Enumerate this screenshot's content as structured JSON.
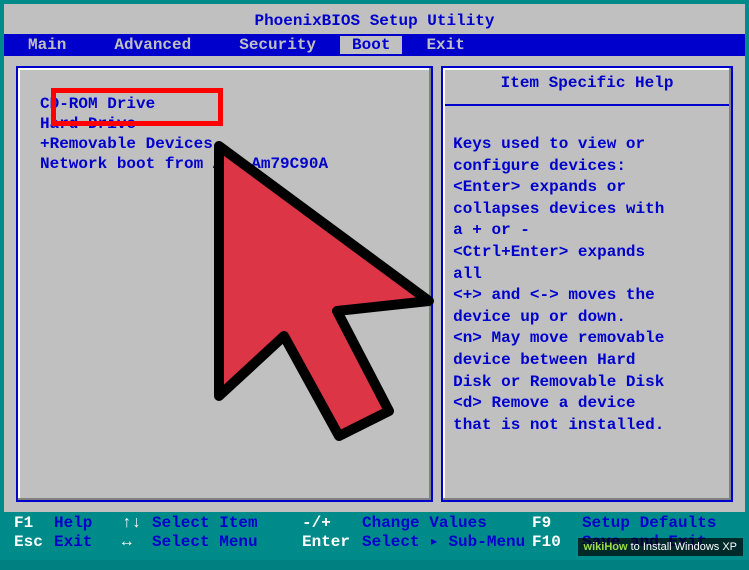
{
  "title": "PhoenixBIOS Setup Utility",
  "menu": {
    "items": [
      "Main",
      "Advanced",
      "Security",
      "Boot",
      "Exit"
    ],
    "active": "Boot"
  },
  "boot_order": [
    {
      "label": " CD-ROM Drive",
      "selected": true
    },
    {
      "label": " Hard Drive",
      "selected": false
    },
    {
      "label": "+Removable Devices",
      "selected": false
    },
    {
      "label": " Network boot from AMD Am79C90A",
      "selected": false
    }
  ],
  "help": {
    "header": "Item Specific Help",
    "body": "Keys used to view or\nconfigure devices:\n<Enter> expands or\ncollapses devices with\na + or -\n<Ctrl+Enter> expands\nall\n<+> and <-> moves the\ndevice up or down.\n<n> May move removable\ndevice between Hard\nDisk or Removable Disk\n<d> Remove a device\nthat is not installed."
  },
  "footer": {
    "f1_key": "F1",
    "f1_label": "Help",
    "arrows1": "↑↓",
    "select_item": "Select Item",
    "plusminus": "-/+",
    "change_values": "Change Values",
    "f9_key": "F9",
    "f9_label": "Setup Defaults",
    "esc_key": "Esc",
    "esc_label": "Exit",
    "arrows2": "↔",
    "select_menu": "Select Menu",
    "enter_key": "Enter",
    "select_submenu": "Select ▸ Sub-Menu",
    "f10_key": "F10",
    "f10_label": "Save and Exit"
  },
  "watermark": {
    "brand": "wikiHow",
    "text": " to Install Windows XP"
  },
  "colors": {
    "teal": "#008b8b",
    "blue": "#0000cd",
    "gray": "#c0c0c0",
    "red": "#ff0000"
  }
}
